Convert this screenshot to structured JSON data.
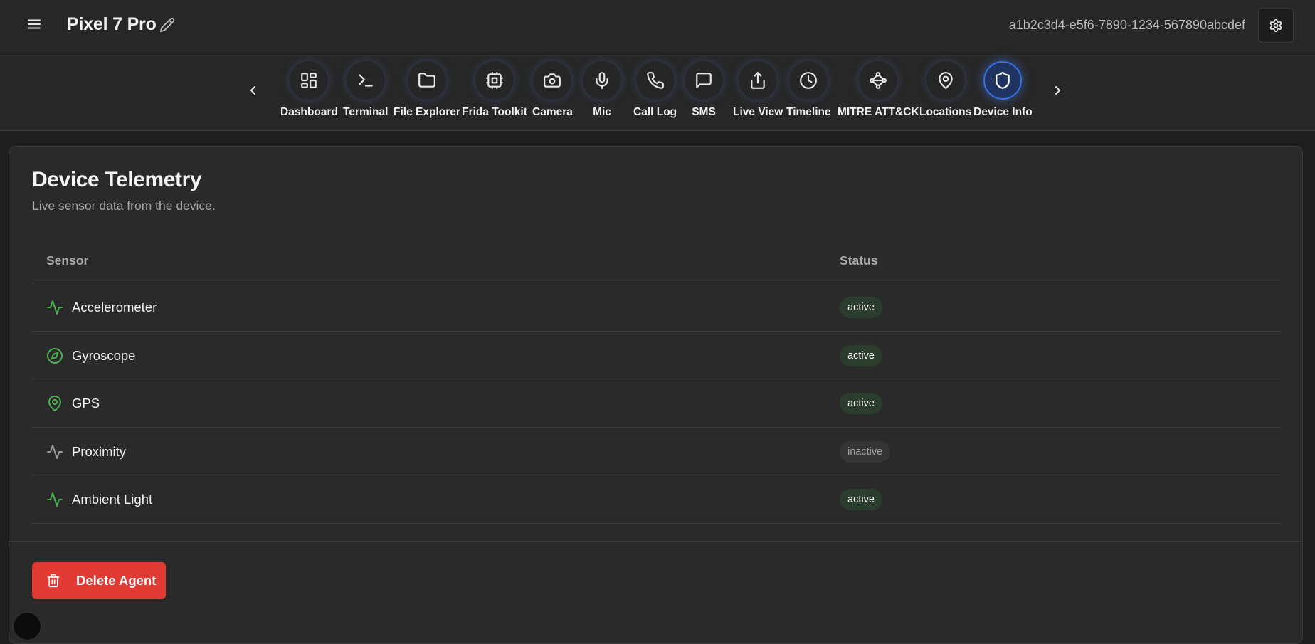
{
  "header": {
    "device_name": "Pixel 7 Pro",
    "device_id": "a1b2c3d4-e5f6-7890-1234-567890abcdef"
  },
  "nav": {
    "items": [
      {
        "label": "Dashboard",
        "icon": "dashboard-icon"
      },
      {
        "label": "Terminal",
        "icon": "terminal-icon"
      },
      {
        "label": "File Explorer",
        "icon": "folder-icon"
      },
      {
        "label": "Frida Toolkit",
        "icon": "cpu-icon"
      },
      {
        "label": "Camera",
        "icon": "camera-icon"
      },
      {
        "label": "Mic",
        "icon": "mic-icon"
      },
      {
        "label": "Call Log",
        "icon": "phone-icon"
      },
      {
        "label": "SMS",
        "icon": "message-icon"
      },
      {
        "label": "Live View",
        "icon": "share-icon"
      },
      {
        "label": "Timeline",
        "icon": "clock-icon"
      },
      {
        "label": "MITRE ATT&CK",
        "icon": "workflow-icon"
      },
      {
        "label": "Locations",
        "icon": "map-pin-icon"
      },
      {
        "label": "Device Info",
        "icon": "shield-icon"
      }
    ],
    "active": "Device Info"
  },
  "telemetry": {
    "title": "Device Telemetry",
    "subtitle": "Live sensor data from the device.",
    "columns": {
      "sensor": "Sensor",
      "status": "Status"
    },
    "rows": [
      {
        "sensor": "Accelerometer",
        "status": "active",
        "icon": "activity-icon"
      },
      {
        "sensor": "Gyroscope",
        "status": "active",
        "icon": "compass-icon"
      },
      {
        "sensor": "GPS",
        "status": "active",
        "icon": "map-pin-icon"
      },
      {
        "sensor": "Proximity",
        "status": "inactive",
        "icon": "activity-icon"
      },
      {
        "sensor": "Ambient Light",
        "status": "active",
        "icon": "activity-icon"
      }
    ]
  },
  "actions": {
    "delete_label": "Delete Agent"
  },
  "colors": {
    "background": "#1f1f1f",
    "panel": "#2a2a2a",
    "accent": "#3b6fdc",
    "sensor_active": "#4caf50",
    "sensor_inactive": "#9a9a9a",
    "danger": "#e23b35"
  }
}
